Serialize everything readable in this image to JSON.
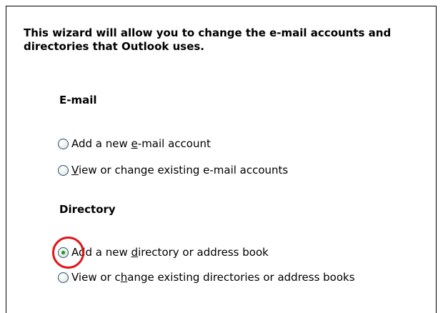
{
  "wizard": {
    "intro_text": "This wizard will allow you to change the e-mail accounts and directories that Outlook uses."
  },
  "email_section": {
    "heading": "E-mail",
    "options": [
      {
        "label_before": "Add a new ",
        "label_accel": "e",
        "label_after": "-mail account",
        "selected": false
      },
      {
        "label_before": "",
        "label_accel": "V",
        "label_after": "iew or change existing e-mail accounts",
        "selected": false
      }
    ]
  },
  "directory_section": {
    "heading": "Directory",
    "options": [
      {
        "label_before": "Add a new ",
        "label_accel": "d",
        "label_after": "irectory or address book",
        "selected": true
      },
      {
        "label_before": "View or c",
        "label_accel": "h",
        "label_after": "ange existing directories or address books",
        "selected": false
      }
    ]
  },
  "annotation": {
    "highlight_color": "#e0171b",
    "highlight_target": "directory_section.options.0"
  }
}
